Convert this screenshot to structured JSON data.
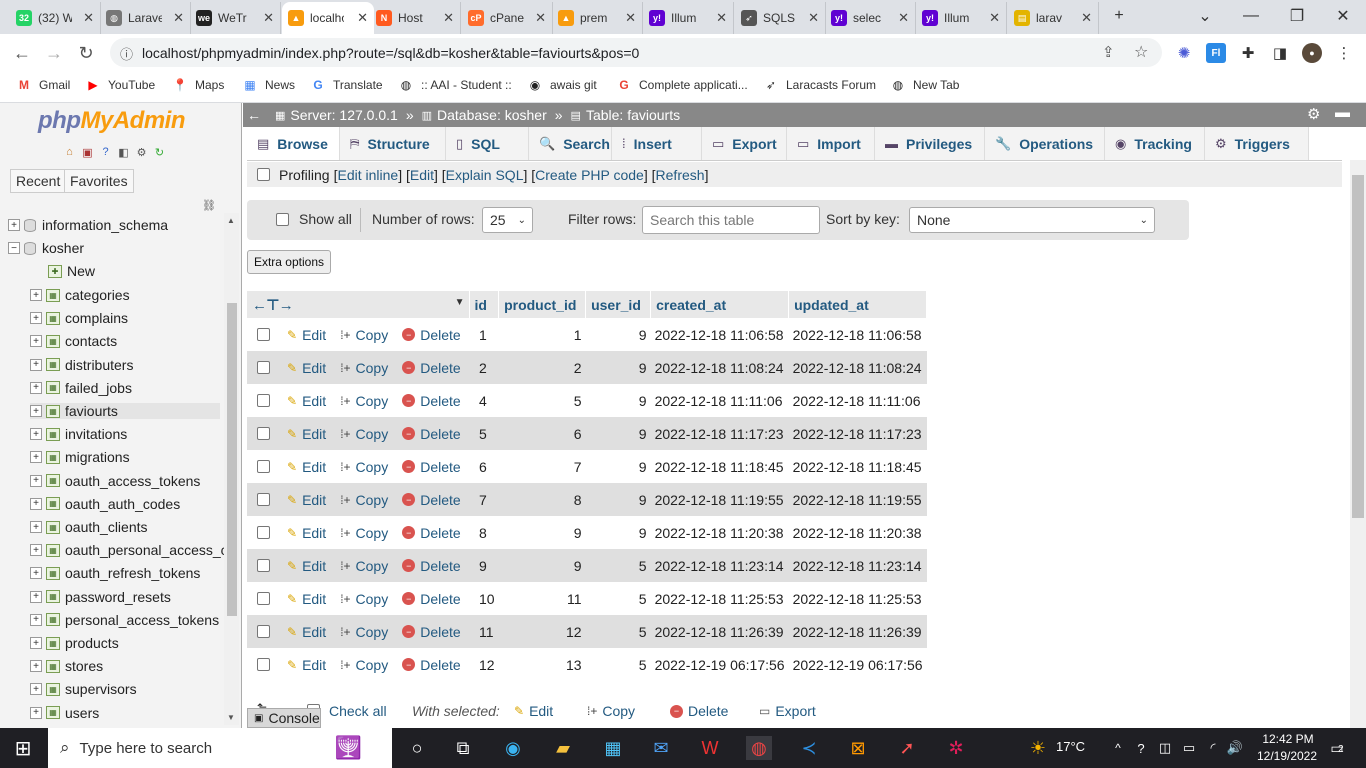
{
  "browser": {
    "tabs": [
      {
        "icon": "whatsapp-icon",
        "label": "(32) W",
        "color": "#25d366",
        "glyph": "32"
      },
      {
        "icon": "globe-icon",
        "label": "Laravel",
        "color": "#777",
        "glyph": "◍"
      },
      {
        "icon": "wetransfer-icon",
        "label": "WeTr",
        "color": "#222",
        "glyph": "we"
      },
      {
        "icon": "phpmyadmin-icon",
        "label": "localhost",
        "color": "#f89c0e",
        "glyph": "▲"
      },
      {
        "icon": "hostinger-icon",
        "label": "Host",
        "color": "#ff5a1f",
        "glyph": "N"
      },
      {
        "icon": "cpanel-icon",
        "label": "cPanel",
        "color": "#ff6c2c",
        "glyph": "cP"
      },
      {
        "icon": "phpmyadmin-icon",
        "label": "prem",
        "color": "#f89c0e",
        "glyph": "▲"
      },
      {
        "icon": "yahoo-icon",
        "label": "Illum",
        "color": "#6001d2",
        "glyph": "y!"
      },
      {
        "icon": "sqls-icon",
        "label": "SQLS",
        "color": "#555",
        "glyph": "➶"
      },
      {
        "icon": "yahoo-icon",
        "label": "selec",
        "color": "#6001d2",
        "glyph": "y!"
      },
      {
        "icon": "yahoo-icon",
        "label": "Illum",
        "color": "#6001d2",
        "glyph": "y!"
      },
      {
        "icon": "laravel-icon",
        "label": "larav",
        "color": "#e3b400",
        "glyph": "▤"
      }
    ],
    "url": "localhost/phpmyadmin/index.php?route=/sql&db=kosher&table=faviourts&pos=0",
    "bookmarks": [
      {
        "icon": "gmail-icon",
        "label": "Gmail",
        "color": "#ea4335",
        "glyph": "M"
      },
      {
        "icon": "youtube-icon",
        "label": "YouTube",
        "color": "#ff0000",
        "glyph": "▶"
      },
      {
        "icon": "maps-icon",
        "label": "Maps",
        "color": "#34a853",
        "glyph": "📍"
      },
      {
        "icon": "news-icon",
        "label": "News",
        "color": "#4285f4",
        "glyph": "▦"
      },
      {
        "icon": "translate-icon",
        "label": "Translate",
        "color": "#4285f4",
        "glyph": "G"
      },
      {
        "icon": "globe-icon",
        "label": ":: AAI - Student ::",
        "color": "#222",
        "glyph": "◍"
      },
      {
        "icon": "github-icon",
        "label": "awais git",
        "color": "#222",
        "glyph": "◉"
      },
      {
        "icon": "google-icon",
        "label": "Complete applicati...",
        "color": "#ea4335",
        "glyph": "G"
      },
      {
        "icon": "laracasts-icon",
        "label": "Laracasts Forum",
        "color": "#333",
        "glyph": "➶"
      },
      {
        "icon": "globe-icon",
        "label": "New Tab",
        "color": "#222",
        "glyph": "◍"
      }
    ]
  },
  "pma": {
    "logo_php": "php",
    "logo_rest": "MyAdmin",
    "nav_tabs": [
      "Recent",
      "Favorites"
    ],
    "databases": [
      "information_schema",
      "kosher"
    ],
    "new_label": "New",
    "tables": [
      "categories",
      "complains",
      "contacts",
      "distributers",
      "failed_jobs",
      "faviourts",
      "invitations",
      "migrations",
      "oauth_access_tokens",
      "oauth_auth_codes",
      "oauth_clients",
      "oauth_personal_access_cl",
      "oauth_refresh_tokens",
      "password_resets",
      "personal_access_tokens",
      "products",
      "stores",
      "supervisors",
      "users"
    ],
    "selected_table": "faviourts",
    "breadcrumb": {
      "server": "Server: 127.0.0.1",
      "database": "Database: kosher",
      "table": "Table: faviourts"
    },
    "menu": [
      {
        "icon": "browse-icon",
        "label": "Browse",
        "glyph": "▤"
      },
      {
        "icon": "structure-icon",
        "label": "Structure",
        "glyph": "⛿"
      },
      {
        "icon": "sql-icon",
        "label": "SQL",
        "glyph": "▯"
      },
      {
        "icon": "search-icon",
        "label": "Search",
        "glyph": "🔍"
      },
      {
        "icon": "insert-icon",
        "label": "Insert",
        "glyph": "⁞"
      },
      {
        "icon": "export-icon",
        "label": "Export",
        "glyph": "▭"
      },
      {
        "icon": "import-icon",
        "label": "Import",
        "glyph": "▭"
      },
      {
        "icon": "privileges-icon",
        "label": "Privileges",
        "glyph": "▬"
      },
      {
        "icon": "operations-icon",
        "label": "Operations",
        "glyph": "🔧"
      },
      {
        "icon": "tracking-icon",
        "label": "Tracking",
        "glyph": "◉"
      },
      {
        "icon": "triggers-icon",
        "label": "Triggers",
        "glyph": "⚙"
      }
    ],
    "profiling": {
      "label": "Profiling",
      "links": [
        "Edit inline",
        "Edit",
        "Explain SQL",
        "Create PHP code",
        "Refresh"
      ]
    },
    "navbar": {
      "show_all": "Show all",
      "rows_label": "Number of rows:",
      "rows_value": "25",
      "filter_label": "Filter rows:",
      "filter_placeholder": "Search this table",
      "sort_label": "Sort by key:",
      "sort_value": "None"
    },
    "extra_options": "Extra options",
    "columns": [
      "id",
      "product_id",
      "user_id",
      "created_at",
      "updated_at"
    ],
    "row_actions": {
      "edit": "Edit",
      "copy": "Copy",
      "delete": "Delete"
    },
    "rows": [
      [
        "1",
        "1",
        "9",
        "2022-12-18 11:06:58",
        "2022-12-18 11:06:58"
      ],
      [
        "2",
        "2",
        "9",
        "2022-12-18 11:08:24",
        "2022-12-18 11:08:24"
      ],
      [
        "4",
        "5",
        "9",
        "2022-12-18 11:11:06",
        "2022-12-18 11:11:06"
      ],
      [
        "5",
        "6",
        "9",
        "2022-12-18 11:17:23",
        "2022-12-18 11:17:23"
      ],
      [
        "6",
        "7",
        "9",
        "2022-12-18 11:18:45",
        "2022-12-18 11:18:45"
      ],
      [
        "7",
        "8",
        "9",
        "2022-12-18 11:19:55",
        "2022-12-18 11:19:55"
      ],
      [
        "8",
        "9",
        "9",
        "2022-12-18 11:20:38",
        "2022-12-18 11:20:38"
      ],
      [
        "9",
        "9",
        "5",
        "2022-12-18 11:23:14",
        "2022-12-18 11:23:14"
      ],
      [
        "10",
        "11",
        "5",
        "2022-12-18 11:25:53",
        "2022-12-18 11:25:53"
      ],
      [
        "11",
        "12",
        "5",
        "2022-12-18 11:26:39",
        "2022-12-18 11:26:39"
      ],
      [
        "12",
        "13",
        "5",
        "2022-12-19 06:17:56",
        "2022-12-19 06:17:56"
      ]
    ],
    "bottom": {
      "check_all": "Check all",
      "with_selected": "With selected:",
      "edit": "Edit",
      "copy": "Copy",
      "delete": "Delete",
      "export": "Export"
    },
    "console": "Console"
  },
  "taskbar": {
    "search_placeholder": "Type here to search",
    "weather": "17°C",
    "time": "12:42 PM",
    "date": "12/19/2022",
    "notification_count": "2"
  }
}
